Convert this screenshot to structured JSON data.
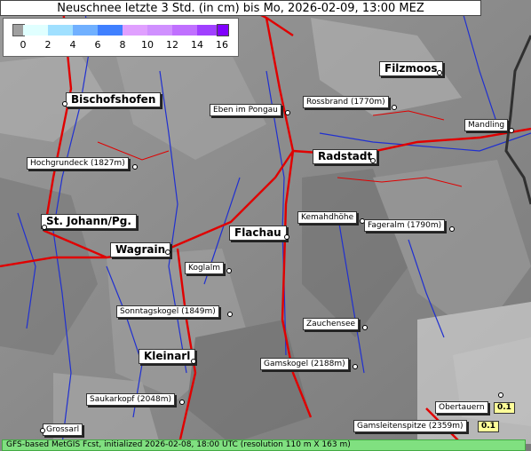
{
  "title": "Neuschnee letzte 3 Std. (in cm) bis Mo, 2026-02-09, 13:00 MEZ",
  "legend": {
    "ticks": [
      "0",
      "2",
      "4",
      "6",
      "8",
      "10",
      "12",
      "14",
      "16"
    ],
    "colors": [
      "#a0a0a0",
      "#e0ffff",
      "#a0e0ff",
      "#70b0ff",
      "#4080ff",
      "#2050e0",
      "#e0a0ff",
      "#c070ff",
      "#a040ff",
      "#8000ff"
    ]
  },
  "places": {
    "filzmoos": "Filzmoos",
    "bischofshofen": "Bischofshofen",
    "eben": "Eben im Pongau",
    "rossbrand": "Rossbrand (1770m)",
    "mandling": "Mandling",
    "hochgrundeck": "Hochgrundeck (1827m)",
    "radstadt": "Radstadt",
    "kemahdhoehe": "Kemahdhöhe",
    "st_johann": "St. Johann/Pg.",
    "flachau": "Flachau",
    "fageralm": "Fageralm (1790m)",
    "wagrain": "Wagrain",
    "koglalm": "Koglalm",
    "sonntagskogel": "Sonntagskogel (1849m)",
    "zauchensee": "Zauchensee",
    "kleinarl": "Kleinarl",
    "gamskogel": "Gamskogel (2188m)",
    "saukarkopf": "Saukarkopf (2048m)",
    "obertauern": "Obertauern",
    "grossarl": "Grossarl",
    "gamsleitenspitze": "Gamsleitenspitze (2359m)"
  },
  "values": {
    "obertauern": "0.1",
    "gamsleitenspitze": "0.1"
  },
  "footer": "GFS-based MetGIS Fcst, initialized 2026-02-08, 18:00 UTC  (resolution 110 m X 163 m)"
}
